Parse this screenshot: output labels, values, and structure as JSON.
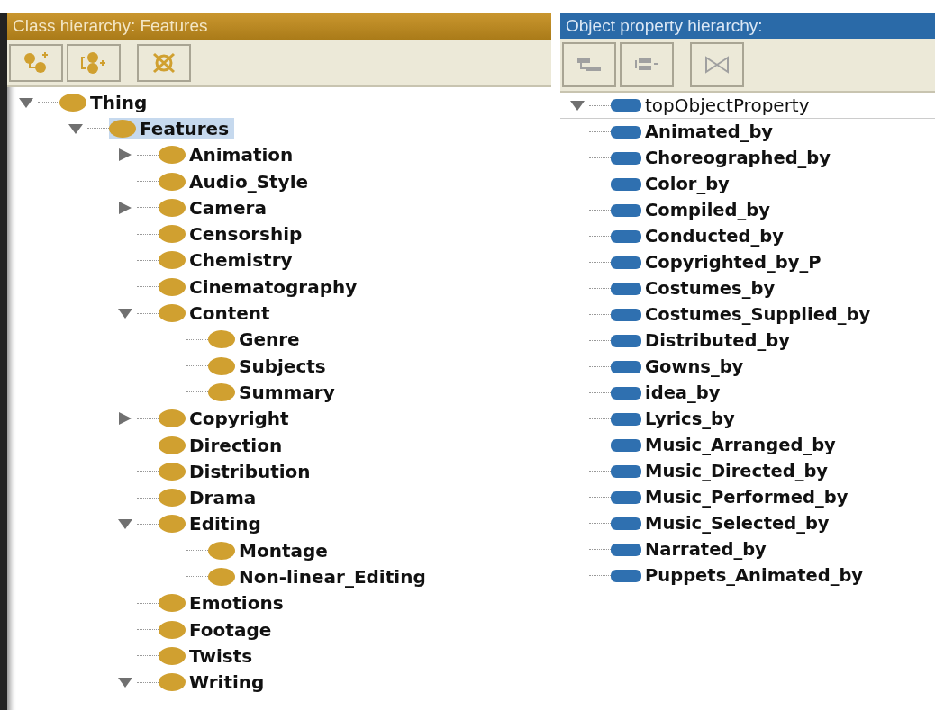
{
  "class_panel": {
    "title": "Class hierarchy: Features",
    "tree": [
      {
        "label": "Thing",
        "expanded": true,
        "selected": false,
        "children": [
          {
            "label": "Features",
            "expanded": true,
            "selected": true,
            "children": [
              {
                "label": "Animation",
                "expanded": false,
                "selected": false
              },
              {
                "label": "Audio_Style",
                "selected": false
              },
              {
                "label": "Camera",
                "expanded": false,
                "selected": false
              },
              {
                "label": "Censorship",
                "selected": false
              },
              {
                "label": "Chemistry",
                "selected": false
              },
              {
                "label": "Cinematography",
                "selected": false
              },
              {
                "label": "Content",
                "expanded": true,
                "selected": false,
                "children": [
                  {
                    "label": "Genre",
                    "selected": false
                  },
                  {
                    "label": "Subjects",
                    "selected": false
                  },
                  {
                    "label": "Summary",
                    "selected": false
                  }
                ]
              },
              {
                "label": "Copyright",
                "expanded": false,
                "selected": false
              },
              {
                "label": "Direction",
                "selected": false
              },
              {
                "label": "Distribution",
                "selected": false
              },
              {
                "label": "Drama",
                "selected": false
              },
              {
                "label": "Editing",
                "expanded": true,
                "selected": false,
                "children": [
                  {
                    "label": "Montage",
                    "selected": false
                  },
                  {
                    "label": "Non-linear_Editing",
                    "selected": false
                  }
                ]
              },
              {
                "label": "Emotions",
                "selected": false
              },
              {
                "label": "Footage",
                "selected": false
              },
              {
                "label": "Twists",
                "selected": false
              },
              {
                "label": "Writing",
                "expanded": true,
                "selected": false
              }
            ]
          }
        ]
      }
    ]
  },
  "property_panel": {
    "title": "Object property hierarchy:",
    "root": {
      "label": "topObjectProperty",
      "expanded": true
    },
    "properties": [
      "Animated_by",
      "Choreographed_by",
      "Color_by",
      "Compiled_by",
      "Conducted_by",
      "Copyrighted_by_P",
      "Costumes_by",
      "Costumes_Supplied_by",
      "Distributed_by",
      "Gowns_by",
      "idea_by",
      "Lyrics_by",
      "Music_Arranged_by",
      "Music_Directed_by",
      "Music_Performed_by",
      "Music_Selected_by",
      "Narrated_by",
      "Puppets_Animated_by"
    ]
  }
}
